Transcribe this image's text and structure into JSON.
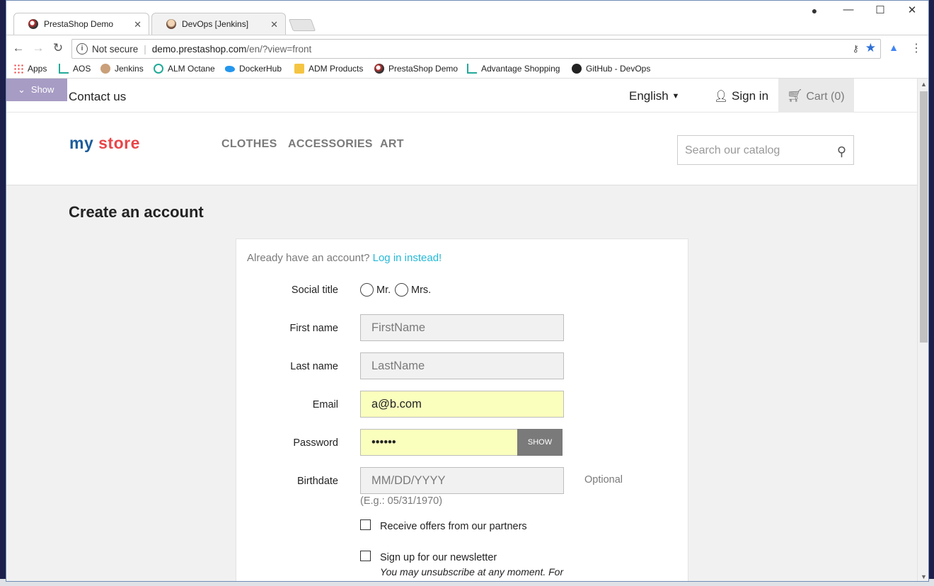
{
  "browser": {
    "tabs": [
      {
        "label": "PrestaShop Demo",
        "active": true
      },
      {
        "label": "DevOps [Jenkins]",
        "active": false
      }
    ],
    "url": {
      "security": "Not secure",
      "host": "demo.prestashop.com",
      "path": "/en/?view=front"
    },
    "bookmarks": [
      "Apps",
      "AOS",
      "Jenkins",
      "ALM Octane",
      "DockerHub",
      "ADM Products",
      "PrestaShop Demo",
      "Advantage Shopping",
      "GitHub - DevOps"
    ]
  },
  "store": {
    "show_button": "Show",
    "contact": "Contact us",
    "language": "English",
    "signin": "Sign in",
    "cart": "Cart (0)",
    "logo": {
      "part1": "my",
      "part2": "store"
    },
    "menu": [
      "CLOTHES",
      "ACCESSORIES",
      "ART"
    ],
    "search_placeholder": "Search our catalog"
  },
  "form": {
    "title": "Create an account",
    "already_text": "Already have an account?",
    "login_link": "Log in instead!",
    "social_title_label": "Social title",
    "social_options": [
      "Mr.",
      "Mrs."
    ],
    "first_name_label": "First name",
    "first_name_placeholder": "FirstName",
    "last_name_label": "Last name",
    "last_name_placeholder": "LastName",
    "email_label": "Email",
    "email_value": "a@b.com",
    "password_label": "Password",
    "password_value": "••••••",
    "show_label": "SHOW",
    "birthdate_label": "Birthdate",
    "birthdate_placeholder": "MM/DD/YYYY",
    "optional": "Optional",
    "example": "(E.g.: 05/31/1970)",
    "offers_label": "Receive offers from our partners",
    "newsletter_label": "Sign up for our newsletter",
    "unsubscribe": "You may unsubscribe at any moment. For"
  },
  "colors": {
    "accent": "#25b9d7",
    "autofill": "#faffbd"
  }
}
